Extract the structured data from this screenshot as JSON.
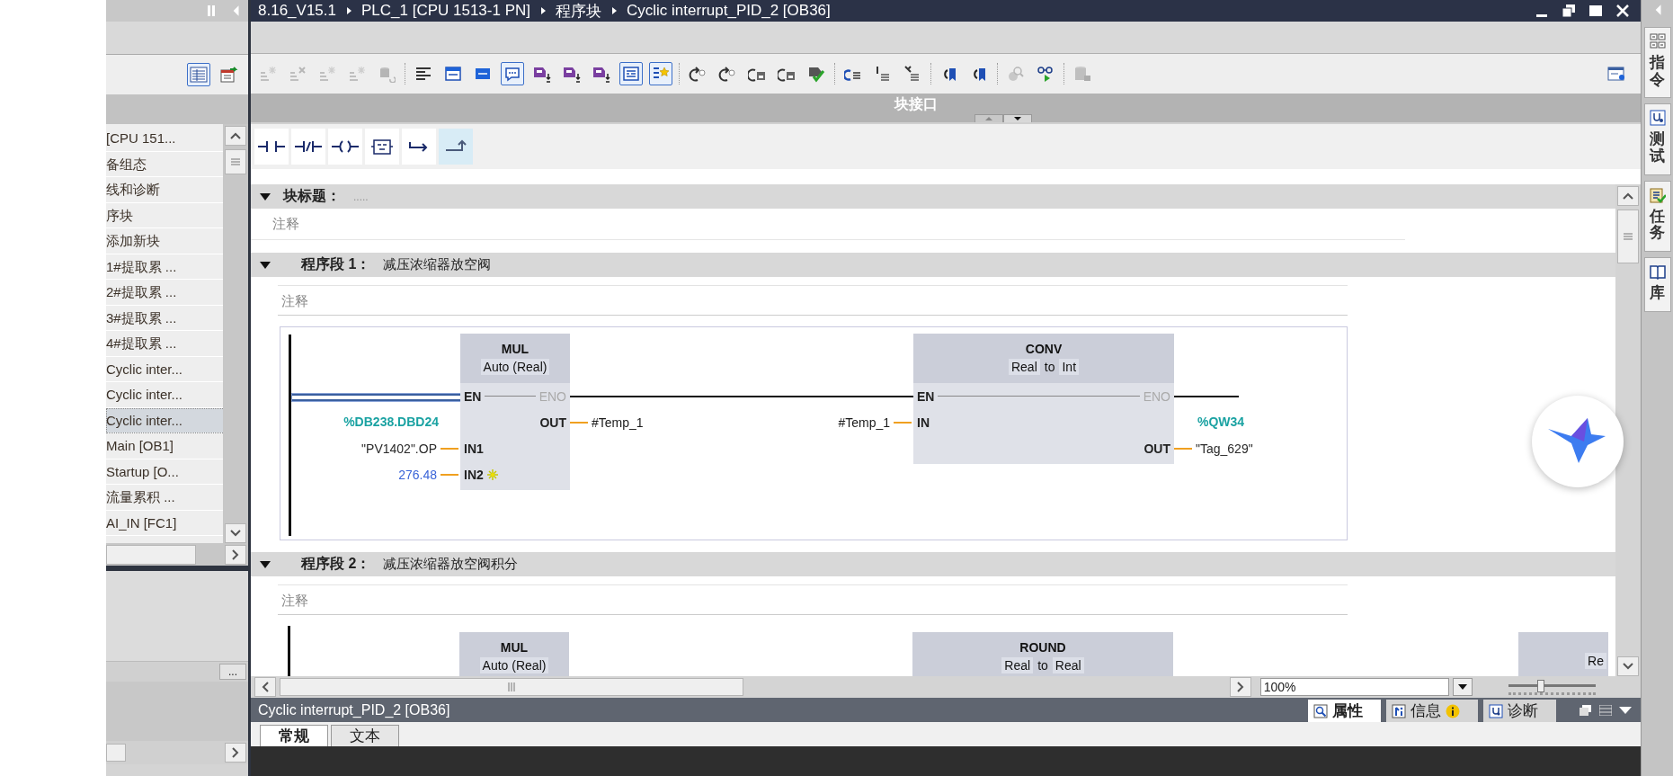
{
  "project_tree": {
    "toolbar": [
      {
        "selected": true
      },
      {
        "selected": false
      }
    ],
    "items": [
      {
        "label": "[CPU 151...",
        "selected": false
      },
      {
        "label": "备组态",
        "selected": false
      },
      {
        "label": "线和诊断",
        "selected": false
      },
      {
        "label": "序块",
        "selected": false
      },
      {
        "label": "添加新块",
        "selected": false
      },
      {
        "label": "1#提取累 ...",
        "selected": false
      },
      {
        "label": "2#提取累 ...",
        "selected": false
      },
      {
        "label": "3#提取累 ...",
        "selected": false
      },
      {
        "label": "4#提取累 ...",
        "selected": false
      },
      {
        "label": "Cyclic inter...",
        "selected": false
      },
      {
        "label": "Cyclic inter...",
        "selected": false
      },
      {
        "label": "Cyclic inter...",
        "selected": true
      },
      {
        "label": "Main [OB1]",
        "selected": false
      },
      {
        "label": "Startup [O...",
        "selected": false
      },
      {
        "label": "流量累积 ...",
        "selected": false
      },
      {
        "label": "AI_IN [FC1]",
        "selected": false
      }
    ],
    "more_button": "..."
  },
  "editor": {
    "breadcrumb": [
      "8.16_V15.1",
      "PLC_1 [CPU 1513-1 PN]",
      "程序块",
      "Cyclic interrupt_PID_2 [OB36]"
    ],
    "toolbar_buttons": [
      {
        "selected": false,
        "disabled": true
      },
      {
        "selected": false,
        "disabled": true
      },
      {
        "selected": false,
        "disabled": true
      },
      {
        "selected": false,
        "disabled": true
      },
      {
        "selected": false,
        "disabled": true
      },
      {
        "selected": false,
        "disabled": false
      },
      {
        "selected": false,
        "disabled": false
      },
      {
        "selected": false,
        "disabled": false
      },
      {
        "selected": true,
        "disabled": false
      },
      {
        "selected": false,
        "disabled": false
      },
      {
        "selected": false,
        "disabled": false
      },
      {
        "selected": false,
        "disabled": false
      },
      {
        "selected": true,
        "disabled": false
      },
      {
        "selected": true,
        "disabled": false
      },
      {
        "selected": false,
        "disabled": false
      },
      {
        "selected": false,
        "disabled": false
      },
      {
        "selected": false,
        "disabled": false
      },
      {
        "selected": false,
        "disabled": false
      },
      {
        "selected": false,
        "disabled": false
      },
      {
        "selected": false,
        "disabled": false
      },
      {
        "selected": false,
        "disabled": false
      },
      {
        "selected": false,
        "disabled": false
      },
      {
        "selected": false,
        "disabled": false
      },
      {
        "selected": false,
        "disabled": false
      },
      {
        "selected": false,
        "disabled": true
      },
      {
        "selected": false,
        "disabled": false
      },
      {
        "selected": false,
        "disabled": true
      },
      {
        "selected": false,
        "disabled": false
      }
    ],
    "interface_bar": "块接口",
    "ladder_tools": [
      {
        "selected": false
      },
      {
        "selected": false
      },
      {
        "selected": false
      },
      {
        "selected": false
      },
      {
        "selected": false
      },
      {
        "selected": true
      }
    ],
    "block_title": {
      "label": "块标题：",
      "value": ".....",
      "comment": "注释",
      "expanded": true
    },
    "networks": [
      {
        "title": "程序段 1：",
        "description": "减压浓缩器放空阀",
        "comment": "注释",
        "expanded": true,
        "input_wire_selected": true,
        "boxes": [
          {
            "title": "MUL",
            "type": [
              {
                "text": "Auto (Real)",
                "kind": "type"
              }
            ],
            "rows": [
              {
                "left": {
                  "pin": "EN",
                  "disabled": false
                },
                "right": {
                  "pin": "ENO",
                  "disabled": true
                }
              },
              {
                "left": {
                  "address": "%DB238.DBD24"
                },
                "right": {
                  "pin": "OUT",
                  "disabled": false,
                  "operand": {
                    "symbol": "#Temp_1",
                    "kind": "local"
                  }
                }
              },
              {
                "left": {
                  "pin": "IN1",
                  "disabled": false,
                  "operand": {
                    "symbol": "\"PV1402\".OP",
                    "kind": "tag"
                  }
                }
              },
              {
                "left": {
                  "pin": "IN2",
                  "disabled": false,
                  "expandable": true,
                  "operand": {
                    "symbol": "276.48",
                    "kind": "constant"
                  }
                }
              }
            ]
          },
          {
            "title": "CONV",
            "type": [
              {
                "text": "Real",
                "kind": "type"
              },
              {
                "text": "to",
                "kind": "word"
              },
              {
                "text": "Int",
                "kind": "type"
              }
            ],
            "rows": [
              {
                "left": {
                  "pin": "EN",
                  "disabled": false
                },
                "right": {
                  "pin": "ENO",
                  "disabled": true
                }
              },
              {
                "left": {
                  "pin": "IN",
                  "disabled": false,
                  "operand": {
                    "symbol": "#Temp_1",
                    "kind": "local"
                  }
                },
                "right": {
                  "address": "%QW34"
                }
              },
              {
                "right": {
                  "pin": "OUT",
                  "disabled": false,
                  "operand": {
                    "symbol": "\"Tag_629\"",
                    "kind": "tag"
                  }
                }
              }
            ]
          }
        ]
      },
      {
        "title": "程序段 2：",
        "description": "减压浓缩器放空阀积分",
        "comment": "注释",
        "expanded": true,
        "boxes": [
          {
            "title": "MUL",
            "type": [
              {
                "text": "Auto (Real)",
                "kind": "type"
              }
            ]
          },
          {
            "title": "ROUND",
            "type": [
              {
                "text": "Real",
                "kind": "type"
              },
              {
                "text": "to",
                "kind": "word"
              },
              {
                "text": "Real",
                "kind": "type"
              }
            ]
          },
          {
            "type": [
              {
                "text": "Re",
                "kind": "type"
              }
            ]
          }
        ]
      }
    ],
    "zoom": {
      "value": "100%",
      "level": 0.37
    }
  },
  "inspector": {
    "title": "Cyclic interrupt_PID_2 [OB36]",
    "tabs": [
      {
        "label": "属性",
        "selected": true
      },
      {
        "label": "信息",
        "selected": false
      },
      {
        "label": "诊断",
        "selected": false
      }
    ],
    "subtabs": [
      {
        "label": "常规",
        "selected": true
      },
      {
        "label": "文本",
        "selected": false
      }
    ]
  },
  "task_cards": [
    {
      "label": "指令"
    },
    {
      "label": "测试"
    },
    {
      "label": "任务"
    },
    {
      "label": "库"
    }
  ]
}
